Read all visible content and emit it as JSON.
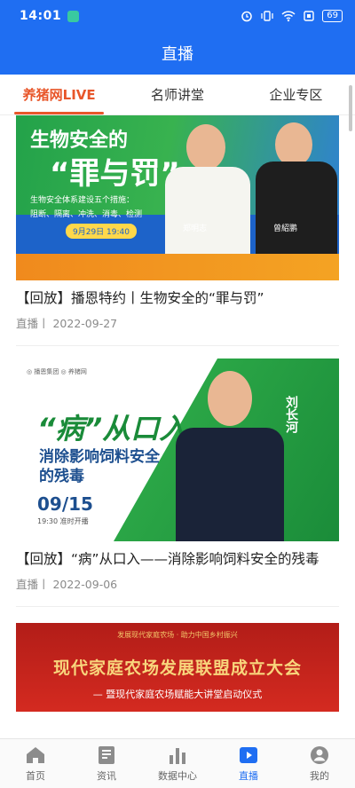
{
  "status_bar": {
    "time": "14:01",
    "battery": "69",
    "icons": [
      "alarm-icon",
      "vibrate-icon",
      "wifi-icon",
      "sim-icon",
      "battery-icon"
    ]
  },
  "app_bar": {
    "title": "直播"
  },
  "tabs": [
    {
      "label": "养猪网LIVE",
      "active": true
    },
    {
      "label": "名师讲堂",
      "active": false
    },
    {
      "label": "企业专区",
      "active": false
    }
  ],
  "feed": [
    {
      "title": "【回放】播恩特约丨生物安全的“罪与罚”",
      "meta": "直播丨 2022-09-27",
      "thumb": {
        "line1": "生物安全的",
        "line2": "“罪与罚”",
        "sub1": "生物安全体系建设五个措施：",
        "sub2": "阻断、隔离、冲洗、消毒、检测",
        "date_pill": "9月29日 19:40",
        "speaker1": "郑明志",
        "speaker2": "曾紹鹏"
      }
    },
    {
      "title": "【回放】“病”从口入——消除影响饲料安全的残毒",
      "meta": "直播丨 2022-09-06",
      "thumb": {
        "logos": "◎ 播恩集团    ◎ 养猪网",
        "big": "“病”从口入",
        "mid1": "消除影响饲料安全",
        "mid2": "的残毒",
        "date": "09/15",
        "time": "19:30 准时开播",
        "host": "刘长河"
      }
    },
    {
      "thumb": {
        "small": "发展现代家庭农场 · 助力中国乡村振兴",
        "main": "现代家庭农场发展联盟成立大会",
        "sub": "— 暨现代家庭农场赋能大讲堂启动仪式"
      }
    }
  ],
  "bottom_nav": [
    {
      "label": "首页",
      "icon": "home-icon",
      "active": false
    },
    {
      "label": "资讯",
      "icon": "news-icon",
      "active": false
    },
    {
      "label": "数据中心",
      "icon": "chart-icon",
      "active": false
    },
    {
      "label": "直播",
      "icon": "live-icon",
      "active": true
    },
    {
      "label": "我的",
      "icon": "profile-icon",
      "active": false
    }
  ],
  "colors": {
    "primary": "#1f6ef2",
    "accent": "#e8562a"
  }
}
